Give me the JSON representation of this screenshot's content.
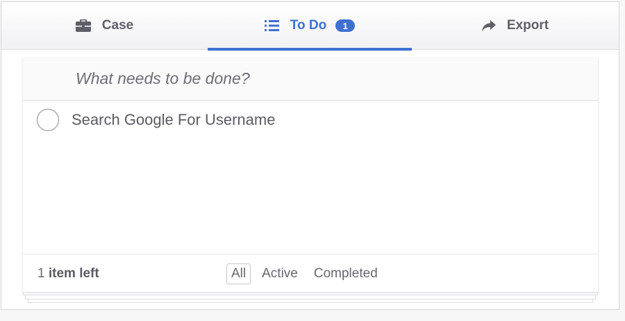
{
  "tabs": [
    {
      "label": "Case",
      "icon": "briefcase-icon",
      "active": false
    },
    {
      "label": "To Do",
      "icon": "list-icon",
      "active": true,
      "badge": "1"
    },
    {
      "label": "Export",
      "icon": "share-arrow-icon",
      "active": false
    }
  ],
  "todo": {
    "new_placeholder": "What needs to be done?",
    "items": [
      {
        "label": "Search Google For Username",
        "completed": false
      }
    ],
    "footer": {
      "count": "1",
      "count_suffix": "item left",
      "filters": [
        "All",
        "Active",
        "Completed"
      ],
      "selected_filter": "All"
    }
  },
  "colors": {
    "accent": "#3f70d1",
    "tab_text": "#5f5f69"
  }
}
